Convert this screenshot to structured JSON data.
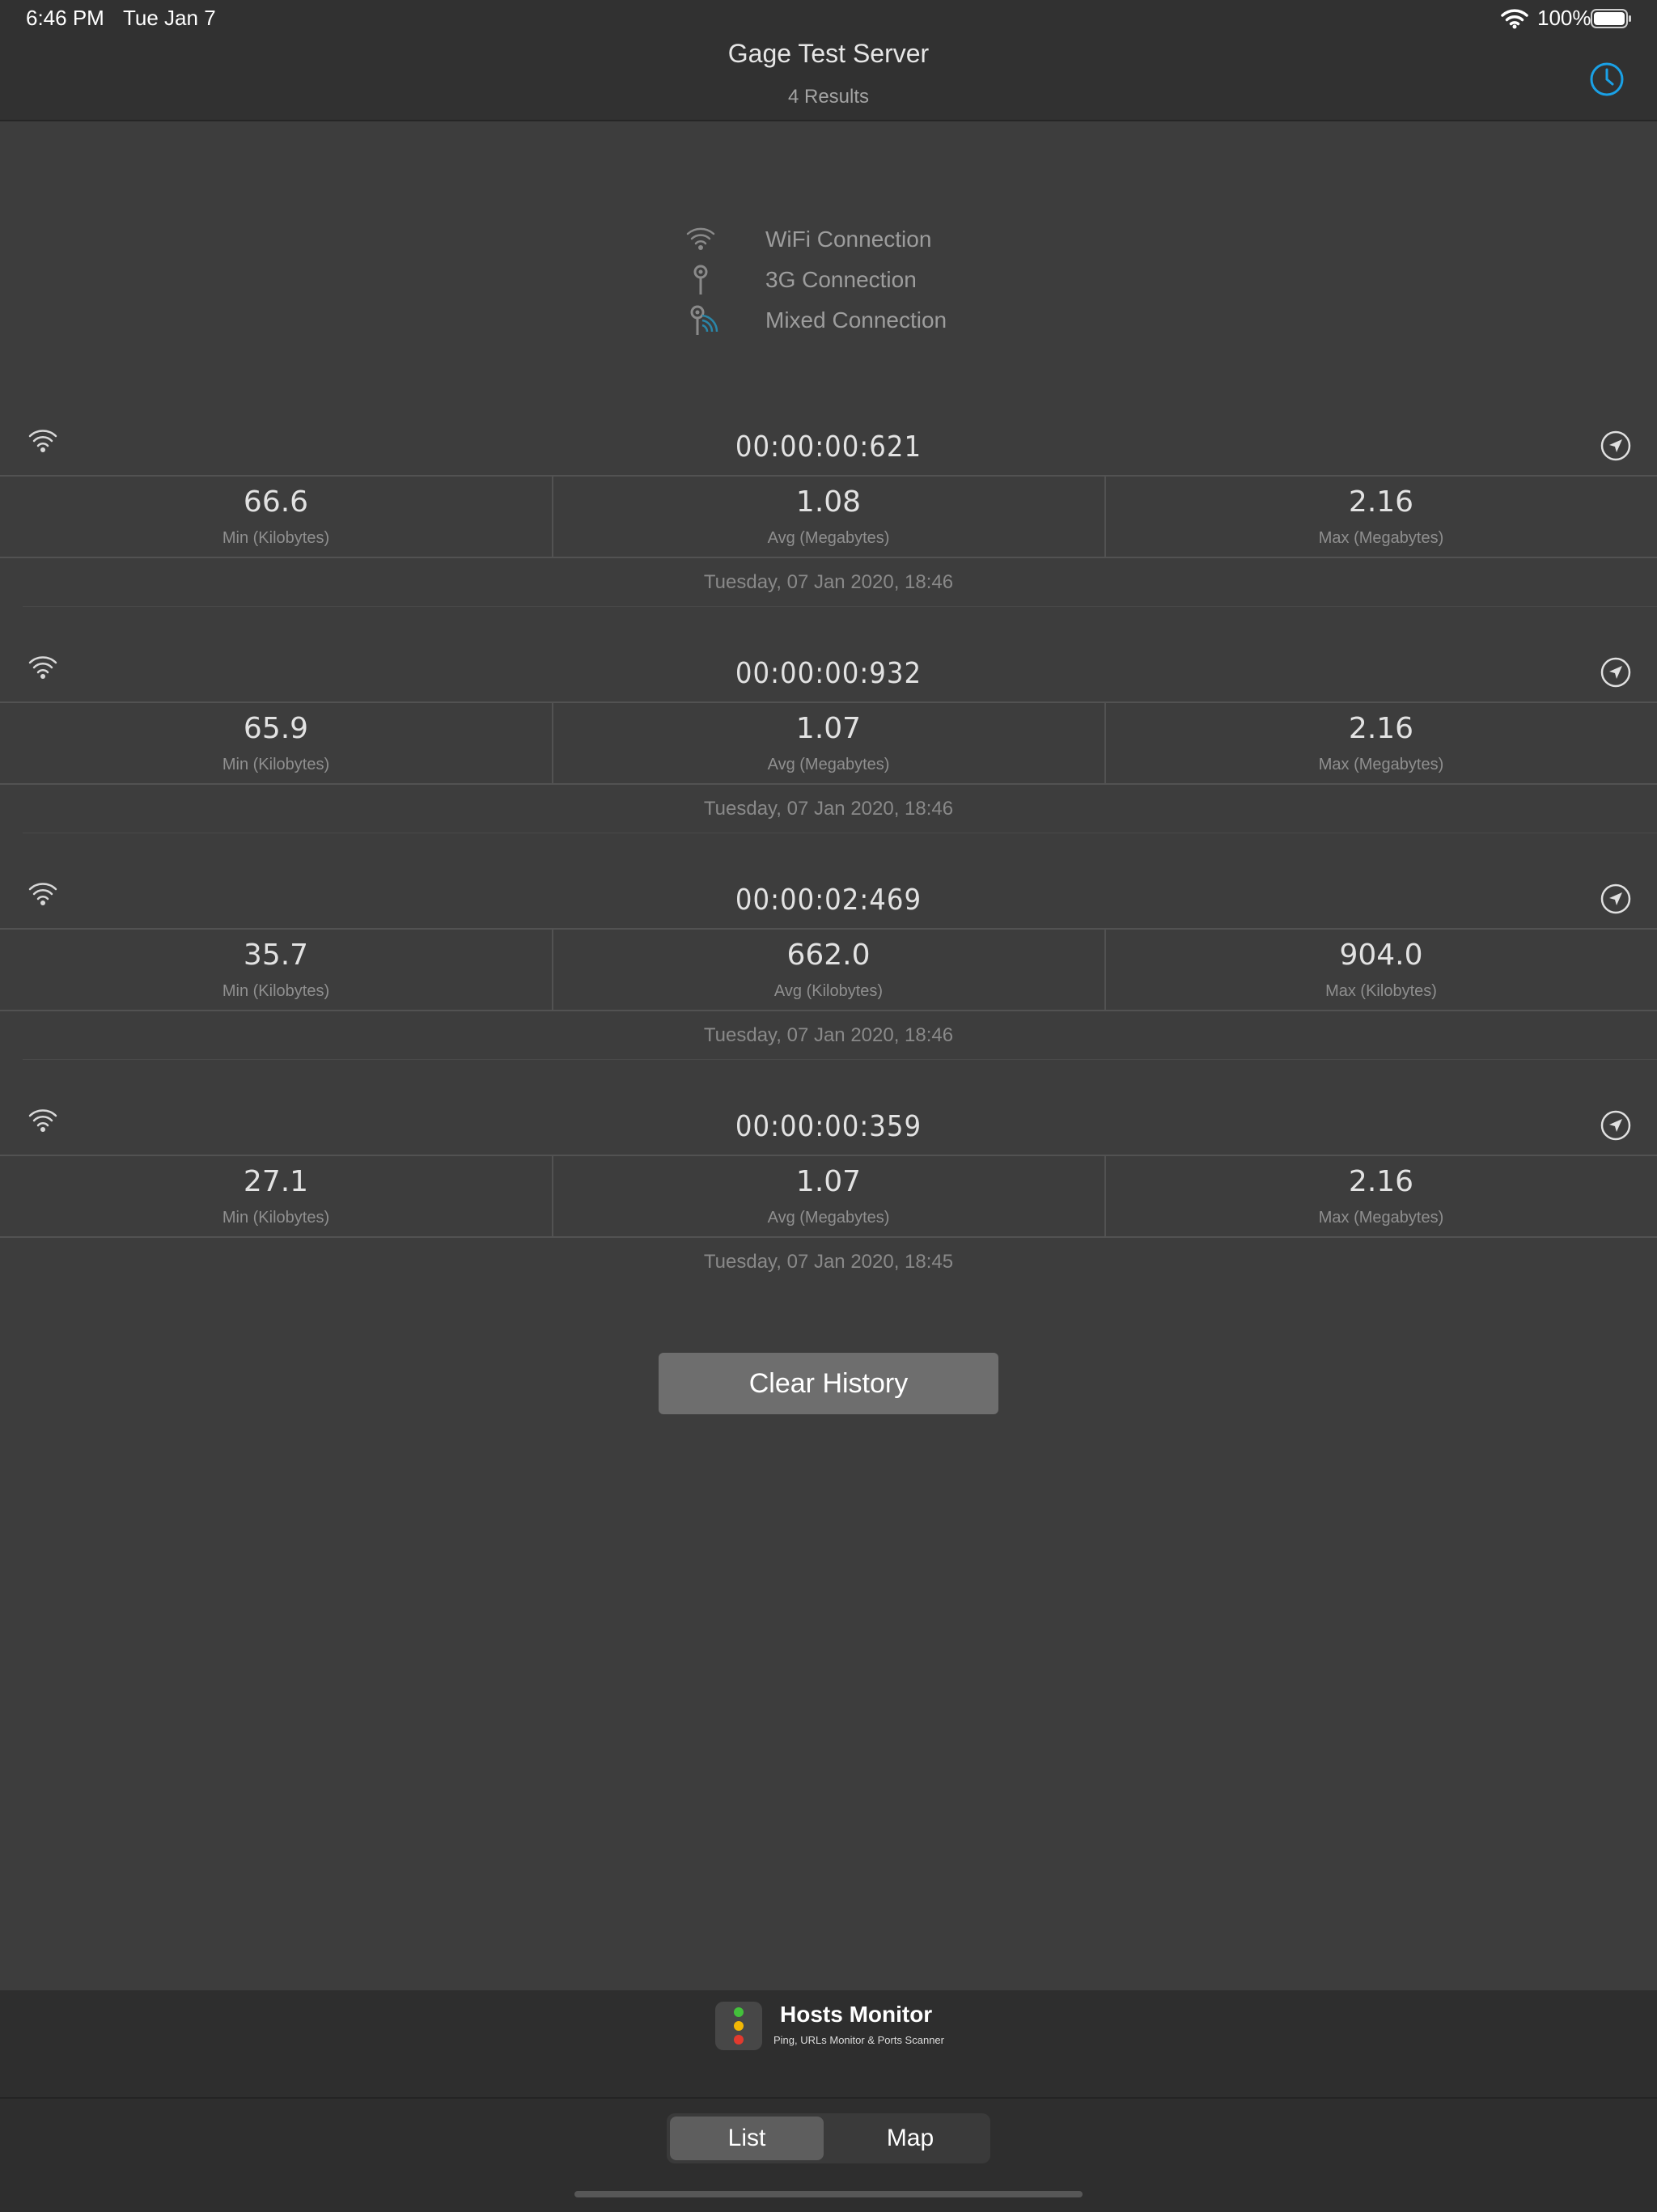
{
  "status_bar": {
    "time": "6:46 PM",
    "date": "Tue Jan 7",
    "battery": "100%"
  },
  "nav": {
    "title": "Gage Test Server",
    "subtitle": "4 Results",
    "history_icon": "clock-icon",
    "accent_color": "#1aa1e6"
  },
  "legend": [
    {
      "icon": "wifi-icon",
      "label": "WiFi Connection"
    },
    {
      "icon": "cellular-icon",
      "label": "3G Connection"
    },
    {
      "icon": "mixed-connection-icon",
      "label": "Mixed Connection"
    }
  ],
  "results": [
    {
      "connection": "wifi",
      "duration": "00:00:00:621",
      "min": {
        "value": "66.6",
        "label": "Min (Kilobytes)"
      },
      "avg": {
        "value": "1.08",
        "label": "Avg (Megabytes)"
      },
      "max": {
        "value": "2.16",
        "label": "Max (Megabytes)"
      },
      "date": "Tuesday, 07 Jan 2020, 18:46"
    },
    {
      "connection": "wifi",
      "duration": "00:00:00:932",
      "min": {
        "value": "65.9",
        "label": "Min (Kilobytes)"
      },
      "avg": {
        "value": "1.07",
        "label": "Avg (Megabytes)"
      },
      "max": {
        "value": "2.16",
        "label": "Max (Megabytes)"
      },
      "date": "Tuesday, 07 Jan 2020, 18:46"
    },
    {
      "connection": "wifi",
      "duration": "00:00:02:469",
      "min": {
        "value": "35.7",
        "label": "Min (Kilobytes)"
      },
      "avg": {
        "value": "662.0",
        "label": "Avg (Kilobytes)"
      },
      "max": {
        "value": "904.0",
        "label": "Max (Kilobytes)"
      },
      "date": "Tuesday, 07 Jan 2020, 18:46"
    },
    {
      "connection": "wifi",
      "duration": "00:00:00:359",
      "min": {
        "value": "27.1",
        "label": "Min (Kilobytes)"
      },
      "avg": {
        "value": "1.07",
        "label": "Avg (Megabytes)"
      },
      "max": {
        "value": "2.16",
        "label": "Max (Megabytes)"
      },
      "date": "Tuesday, 07 Jan 2020, 18:45"
    }
  ],
  "actions": {
    "clear_history": "Clear History"
  },
  "banner": {
    "title": "Hosts Monitor",
    "tagline": "Ping, URLs Monitor & Ports Scanner"
  },
  "tabs": {
    "list": "List",
    "map": "Map",
    "selected": "List"
  }
}
